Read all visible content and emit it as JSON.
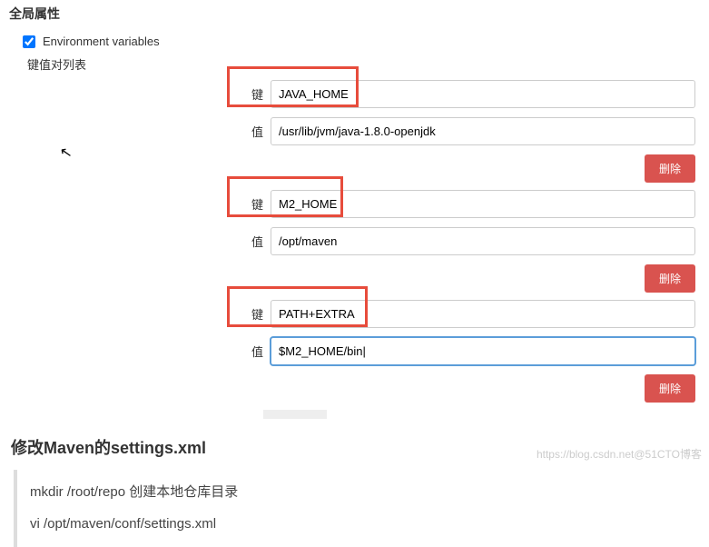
{
  "section": {
    "title": "全局属性"
  },
  "checkbox": {
    "label": "Environment variables",
    "checked": true
  },
  "sub_label": "键值对列表",
  "labels": {
    "key": "键",
    "value": "值",
    "delete": "删除"
  },
  "entries": [
    {
      "key": "JAVA_HOME",
      "value": "/usr/lib/jvm/java-1.8.0-openjdk",
      "focused": false
    },
    {
      "key": "M2_HOME",
      "value": "/opt/maven",
      "focused": false
    },
    {
      "key": "PATH+EXTRA",
      "value": "$M2_HOME/bin|",
      "focused": true
    }
  ],
  "article": {
    "heading": "修改Maven的settings.xml",
    "code_lines": [
      "mkdir /root/repo    创建本地仓库目录",
      "vi /opt/maven/conf/settings.xml"
    ]
  },
  "watermark": "https://blog.csdn.net@51CTO博客"
}
